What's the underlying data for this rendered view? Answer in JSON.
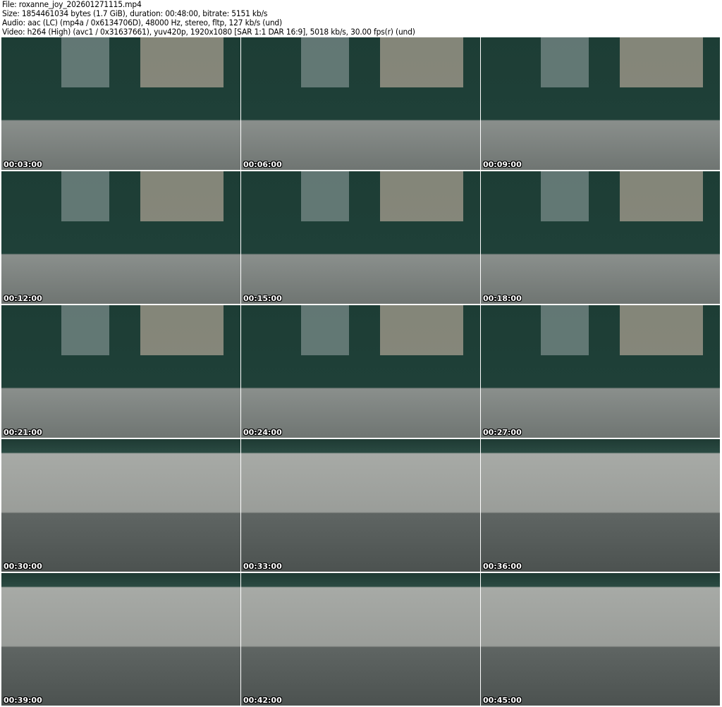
{
  "header": {
    "file": "File: roxanne_joy_202601271115.mp4",
    "size": "Size: 1854461034 bytes (1.7 GiB), duration: 00:48:00, bitrate: 5151 kb/s",
    "audio": "Audio: aac (LC) (mp4a / 0x6134706D), 48000 Hz, stereo, fltp, 127 kb/s (und)",
    "video": "Video: h264 (High) (avc1 / 0x31637661), yuv420p, 1920x1080 [SAR 1:1 DAR 16:9], 5018 kb/s, 30.00 fps(r) (und)"
  },
  "thumbnails": [
    {
      "timestamp": "00:03:00"
    },
    {
      "timestamp": "00:06:00"
    },
    {
      "timestamp": "00:09:00"
    },
    {
      "timestamp": "00:12:00"
    },
    {
      "timestamp": "00:15:00"
    },
    {
      "timestamp": "00:18:00"
    },
    {
      "timestamp": "00:21:00"
    },
    {
      "timestamp": "00:24:00"
    },
    {
      "timestamp": "00:27:00"
    },
    {
      "timestamp": "00:30:00"
    },
    {
      "timestamp": "00:33:00"
    },
    {
      "timestamp": "00:36:00"
    },
    {
      "timestamp": "00:39:00"
    },
    {
      "timestamp": "00:42:00"
    },
    {
      "timestamp": "00:45:00"
    }
  ]
}
